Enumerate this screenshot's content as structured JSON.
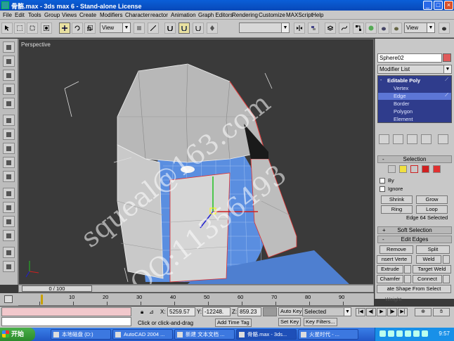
{
  "window": {
    "title": "骨骼.max - 3ds max 6 - Stand-alone License",
    "minimize": "_",
    "maximize": "□",
    "close": "×"
  },
  "menu": [
    "File",
    "Edit",
    "Tools",
    "Group",
    "Views",
    "Create",
    "Modifiers",
    "Character",
    "reactor",
    "Animation",
    "Graph Editors",
    "Rendering",
    "Customize",
    "MAXScript",
    "Help"
  ],
  "toolbar": {
    "ref_coord": "View",
    "named_selection": "",
    "view_right": "View"
  },
  "viewport": {
    "label": "Perspective",
    "watermarks": [
      "squeal@163.com",
      "QQ:11356493"
    ]
  },
  "command_panel": {
    "object_name": "Sphere02",
    "modifier_list": "Modifier List",
    "stack": {
      "parent": "Editable Poly",
      "children": [
        "Vertex",
        "Edge",
        "Border",
        "Polygon",
        "Element"
      ],
      "selected_child": "Edge"
    },
    "selection": {
      "title": "Selection",
      "by_label": "By",
      "ignore_label": "Ignore",
      "shrink": "Shrink",
      "grow": "Grow",
      "ring": "Ring",
      "loop": "Loop",
      "status": "Edge 64 Selected"
    },
    "soft_selection": {
      "title": "Soft Selection"
    },
    "edit_edges": {
      "title": "Edit Edges",
      "remove": "Remove",
      "split": "Split",
      "insert_vertex": "nsert Verte",
      "weld": "Weld",
      "extrude": "Extrude",
      "target_weld": "Target Weld",
      "chamfer": "Chamfer",
      "connect": "Connect",
      "create_shape": "ate Shape From Select",
      "weight": "Weight"
    },
    "rollout_sign": "+",
    "rollout_sign_open": "-"
  },
  "timeline": {
    "frame_display": "0 / 100",
    "ticks": [
      "10",
      "20",
      "30",
      "40",
      "50",
      "60",
      "70",
      "80",
      "90"
    ]
  },
  "status": {
    "x_label": "X:",
    "x_value": "5259.57",
    "y_label": "Y:",
    "y_value": "-12248.",
    "z_label": "Z:",
    "z_value": "859.23",
    "prompt": "Click or click-and-drag",
    "add_time_tag": "Add Time Tag",
    "auto_key": "Auto Key",
    "selected": "Selected",
    "set_key": "Set Key",
    "key_filters": "Key Filters..."
  },
  "taskbar": {
    "start": "开始",
    "tasks": [
      "本地磁盘 (D:)",
      "AutoCAD 2004 ...",
      "新建 文本文档 ...",
      "骨骼.max - 3ds...",
      "火星时代 - ..."
    ],
    "active_task": 3,
    "clock": "9:57"
  },
  "colors": {
    "stack_bg": "#2f3c8c",
    "selected_child": "#5c76d6",
    "edge_highlight": "#e03030",
    "mesh_blue": "#5a8ee0"
  }
}
